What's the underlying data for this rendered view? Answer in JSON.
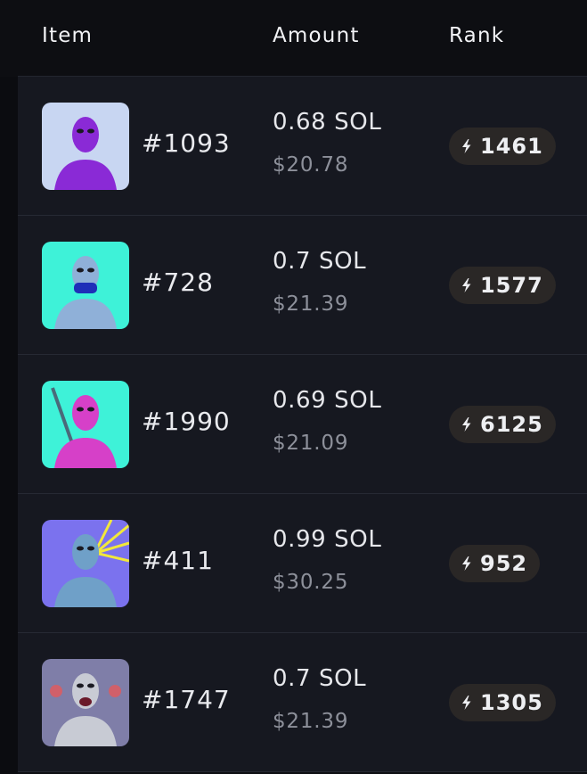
{
  "header": {
    "item_label": "Item",
    "amount_label": "Amount",
    "rank_label": "Rank"
  },
  "rows": [
    {
      "id": "#1093",
      "sol": "0.68 SOL",
      "usd": "$20.78",
      "rank": "1461",
      "thumb_bg": "#c8d6f2",
      "thumb_figure": "#8a2ad6"
    },
    {
      "id": "#728",
      "sol": "0.7 SOL",
      "usd": "$21.39",
      "rank": "1577",
      "thumb_bg": "#3ef2d8",
      "thumb_figure": "#8fb0d8"
    },
    {
      "id": "#1990",
      "sol": "0.69 SOL",
      "usd": "$21.09",
      "rank": "6125",
      "thumb_bg": "#3ef2d8",
      "thumb_figure": "#d640c8"
    },
    {
      "id": "#411",
      "sol": "0.99 SOL",
      "usd": "$30.25",
      "rank": "952",
      "thumb_bg": "#7b72ee",
      "thumb_figure": "#6fa0c8"
    },
    {
      "id": "#1747",
      "sol": "0.7 SOL",
      "usd": "$21.39",
      "rank": "1305",
      "thumb_bg": "#7f7ea8",
      "thumb_figure": "#c8cbd4"
    }
  ],
  "rank_icon": "lightning-rank-icon",
  "colors": {
    "background": "#0d0e12",
    "row_background": "#161820",
    "badge_background": "#2a2726",
    "muted_text": "#8d909a"
  }
}
